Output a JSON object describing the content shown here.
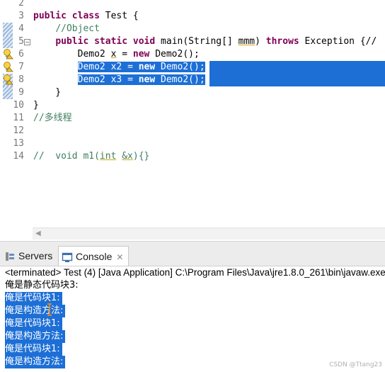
{
  "editor": {
    "lines": [
      {
        "n": "2",
        "parts": []
      },
      {
        "n": "3",
        "parts": [
          {
            "t": "public",
            "k": "kw"
          },
          {
            "t": " "
          },
          {
            "t": "class",
            "k": "kw"
          },
          {
            "t": " Test {"
          }
        ]
      },
      {
        "n": "4",
        "parts": [
          {
            "t": "    "
          },
          {
            "t": "//Object",
            "k": "cm"
          }
        ]
      },
      {
        "n": "5",
        "fold": "−",
        "parts": [
          {
            "t": "    "
          },
          {
            "t": "public",
            "k": "kw"
          },
          {
            "t": " "
          },
          {
            "t": "static",
            "k": "kw"
          },
          {
            "t": " "
          },
          {
            "t": "void",
            "k": "kw"
          },
          {
            "t": " main(String[] "
          },
          {
            "t": "mmm",
            "k": "und"
          },
          {
            "t": ") "
          },
          {
            "t": "throws",
            "k": "kw"
          },
          {
            "t": " Exception {//"
          }
        ]
      },
      {
        "n": "6",
        "parts": [
          {
            "t": "        Demo2 "
          },
          {
            "t": "x",
            "k": "und"
          },
          {
            "t": " = "
          },
          {
            "t": "new",
            "k": "kw"
          },
          {
            "t": " Demo2();"
          }
        ]
      },
      {
        "n": "7",
        "sel": true,
        "parts": [
          {
            "t": "        "
          },
          {
            "t": "Demo2 x2 = ",
            "k": "sel"
          },
          {
            "t": "new",
            "k": "selkw"
          },
          {
            "t": " Demo2();",
            "k": "sel"
          }
        ]
      },
      {
        "n": "8",
        "sel": true,
        "parts": [
          {
            "t": "        "
          },
          {
            "t": "Demo2 x3 = ",
            "k": "sel"
          },
          {
            "t": "new",
            "k": "selkw"
          },
          {
            "t": " Demo2();",
            "k": "sel"
          }
        ]
      },
      {
        "n": "9",
        "parts": [
          {
            "t": "    }"
          }
        ]
      },
      {
        "n": "10",
        "parts": [
          {
            "t": "}"
          }
        ]
      },
      {
        "n": "11",
        "parts": [
          {
            "t": "//",
            "k": "cm"
          },
          {
            "t": "多线程",
            "k": "cmcj"
          }
        ]
      },
      {
        "n": "12",
        "parts": []
      },
      {
        "n": "13",
        "parts": []
      },
      {
        "n": "14",
        "parts": [
          {
            "t": "//  void m1(",
            "k": "cm"
          },
          {
            "t": "int",
            "k": "cmund"
          },
          {
            "t": " ",
            "k": "cm"
          },
          {
            "t": "&x",
            "k": "cmund"
          },
          {
            "t": "){}",
            "k": "cm"
          }
        ]
      }
    ]
  },
  "views": {
    "servers_label": "Servers",
    "console_label": "Console",
    "console_close": "✕"
  },
  "console": {
    "header": "<terminated> Test (4) [Java Application] C:\\Program Files\\Java\\jre1.8.0_261\\bin\\javaw.exe",
    "lines": [
      {
        "text": "俺是静态代码块3:",
        "sel": false
      },
      {
        "text": "俺是代码块1:",
        "sel": true
      },
      {
        "text": "俺是构造方法:",
        "sel": true
      },
      {
        "text": "俺是代码块1:",
        "sel": true
      },
      {
        "text": "俺是构造方法:",
        "sel": true
      },
      {
        "text": "俺是代码块1:",
        "sel": true
      },
      {
        "text": "俺是构造方法:",
        "sel": true
      }
    ]
  },
  "watermark": "CSDN @Ttang23",
  "colors": {
    "keyword": "#7f0055",
    "comment": "#3f7f5f",
    "selection": "#1d6fd6"
  }
}
